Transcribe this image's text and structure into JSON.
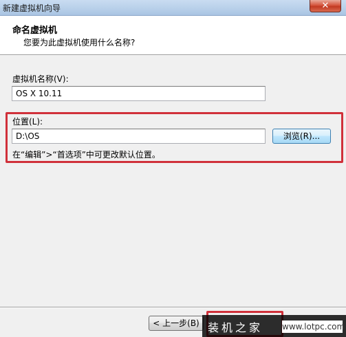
{
  "window": {
    "title": "新建虚拟机向导",
    "close_glyph": "✕"
  },
  "header": {
    "title": "命名虚拟机",
    "subtitle": "您要为此虚拟机使用什么名称?"
  },
  "form": {
    "vm_name_label": "虚拟机名称(V):",
    "vm_name_value": "OS X 10.11",
    "location_label": "位置(L):",
    "location_value": "D:\\OS",
    "browse_label": "浏览(R)...",
    "hint": "在“编辑”>“首选项”中可更改默认位置。"
  },
  "footer": {
    "back_label": "< 上一步(B)"
  },
  "watermark": {
    "brand": "装机之家",
    "url": "www.lotpc.com"
  },
  "colors": {
    "highlight": "#d0303a"
  }
}
